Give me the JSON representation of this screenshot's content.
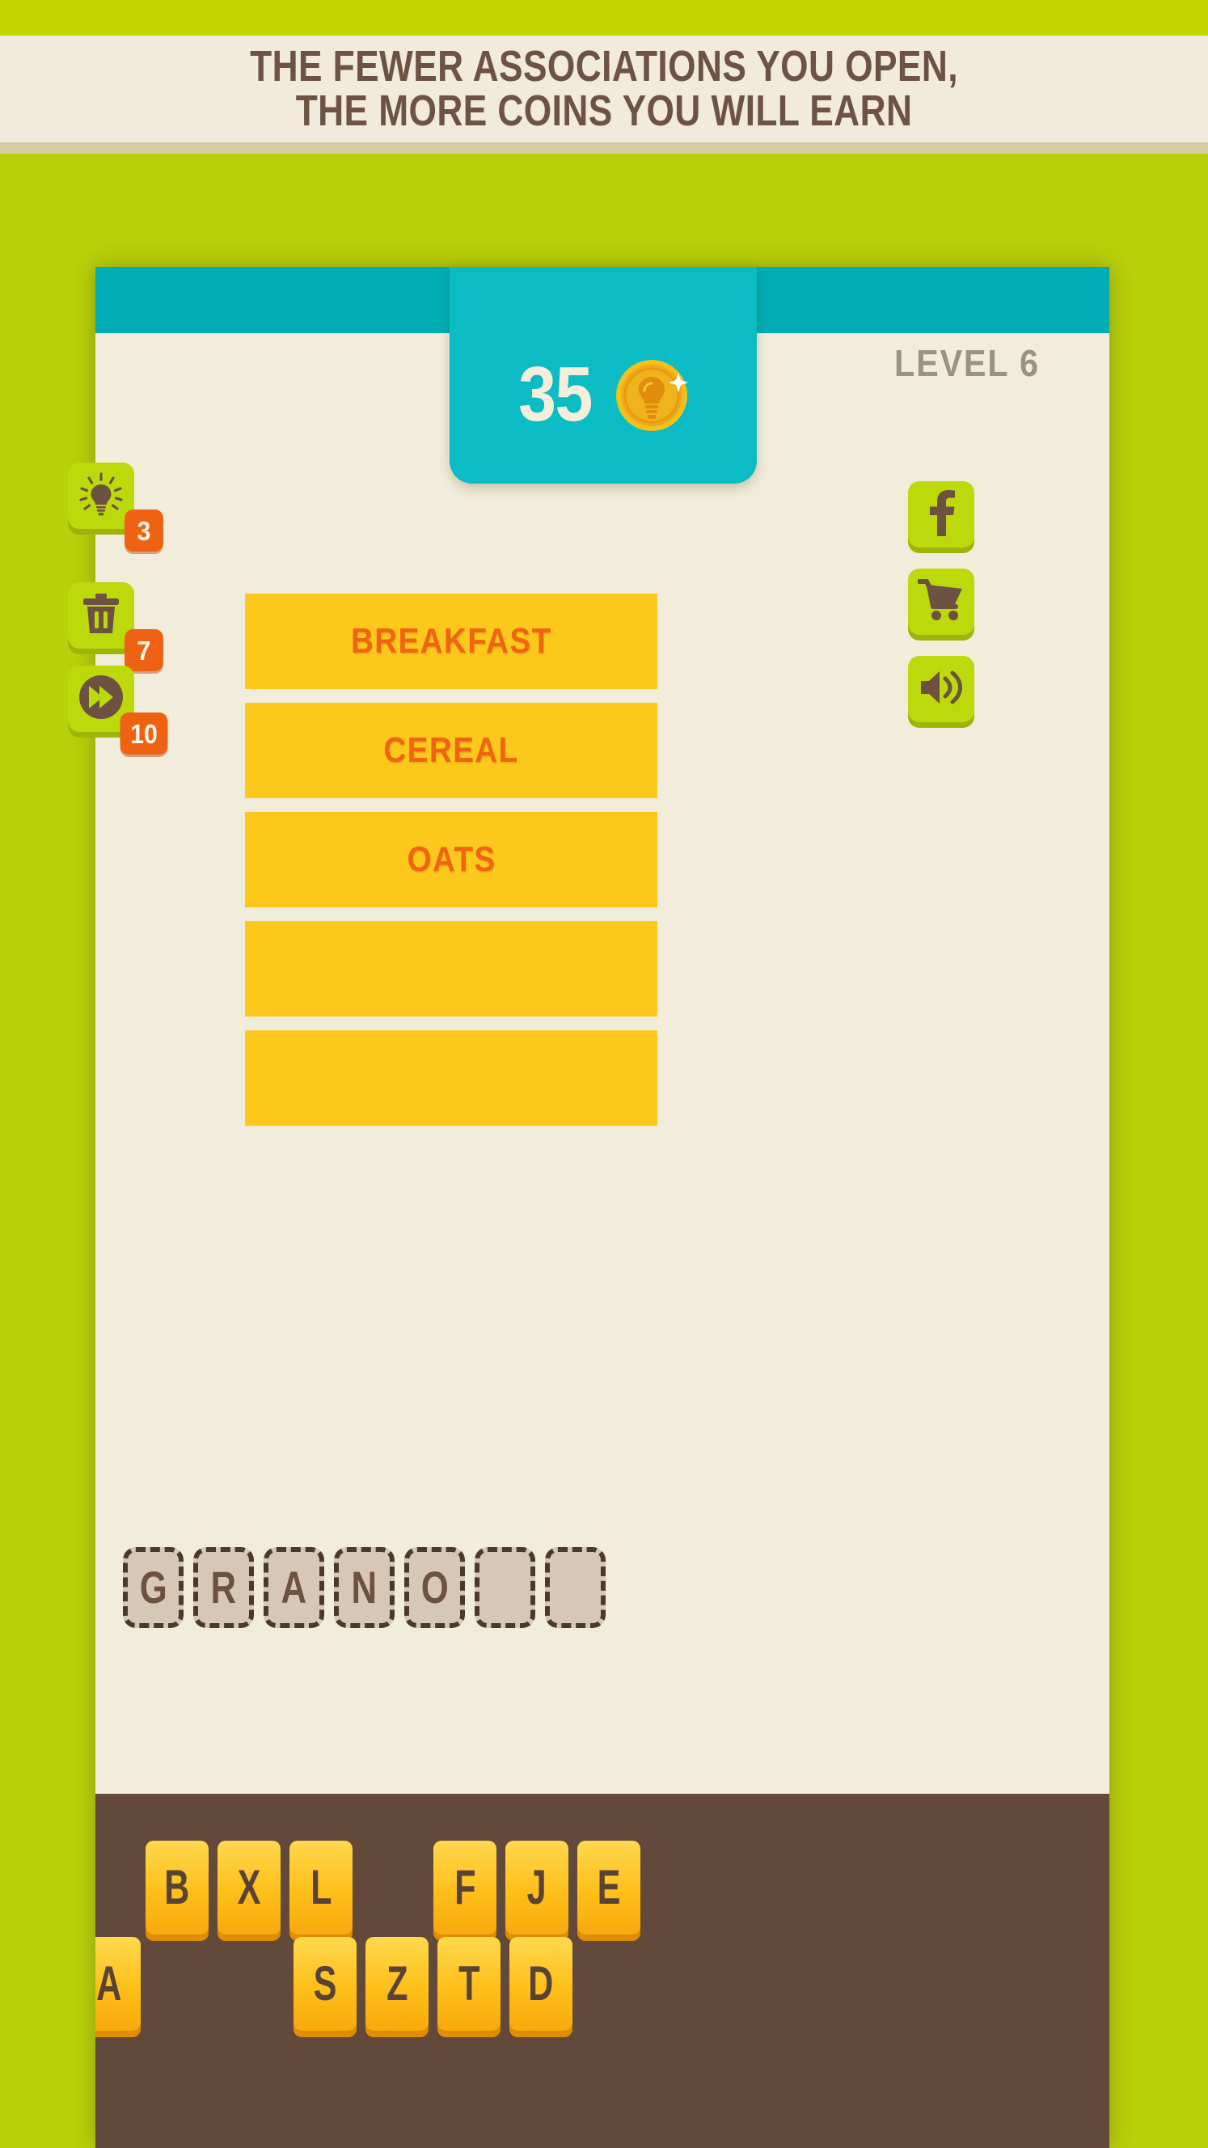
{
  "banner": {
    "line1": "THE FEWER ASSOCIATIONS YOU OPEN,",
    "line2": "THE MORE COINS YOU WILL EARN"
  },
  "header": {
    "coin_count": "35",
    "coin_icon": "lightbulb-coin-icon",
    "level_label": "LEVEL 6"
  },
  "word_bars": [
    {
      "text": "BREAKFAST",
      "revealed": true
    },
    {
      "text": "CEREAL",
      "revealed": true
    },
    {
      "text": "OATS",
      "revealed": true
    },
    {
      "text": "",
      "revealed": false
    },
    {
      "text": "",
      "revealed": false
    }
  ],
  "left_buttons": [
    {
      "name": "hint-button",
      "icon": "lightbulb-icon",
      "badge": "3"
    },
    {
      "name": "delete-letters-button",
      "icon": "trash-icon",
      "badge": "7"
    },
    {
      "name": "skip-level-button",
      "icon": "fast-forward-icon",
      "badge": "10"
    }
  ],
  "right_buttons": [
    {
      "name": "facebook-button",
      "icon": "facebook-icon"
    },
    {
      "name": "shop-button",
      "icon": "shopping-cart-icon"
    },
    {
      "name": "sound-button",
      "icon": "speaker-icon"
    }
  ],
  "answer_slots": [
    "G",
    "R",
    "A",
    "N",
    "O",
    "",
    ""
  ],
  "keyboard": {
    "row1": [
      "B",
      "X",
      "L",
      "",
      "F",
      "J",
      "E"
    ],
    "row2": [
      "A",
      "",
      "",
      "S",
      "Z",
      "T",
      "D"
    ]
  },
  "colors": {
    "background_green": "#b9d10a",
    "banner_bg": "#f2eada",
    "banner_text": "#6d5344",
    "card_bg": "#f2ecda",
    "header_teal": "#01adb5",
    "coin_tab_teal": "#0bbcc4",
    "word_bar": "#fdc81c",
    "word_text": "#ef6511",
    "button_green": "#bcd90c",
    "badge_orange": "#ee6313",
    "keyboard_bg": "#63493a",
    "key_yellow": "#fdc01a",
    "slot_fill": "#d6c8b4",
    "slot_border": "#4b3a2c",
    "icon_brown": "#6d5141",
    "level_gray": "#9b9282"
  }
}
